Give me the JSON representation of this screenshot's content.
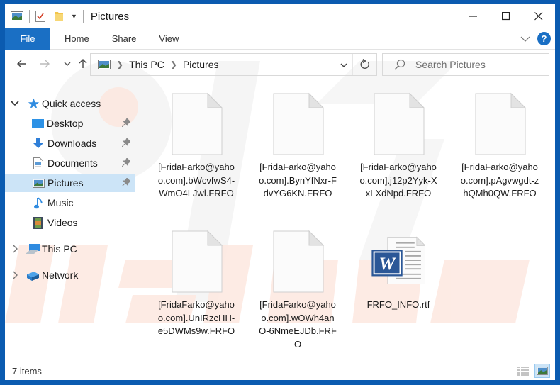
{
  "window": {
    "title": "Pictures",
    "controls": {
      "minimize": "minimize",
      "maximize": "maximize",
      "close": "close"
    }
  },
  "ribbon": {
    "file_tab": "File",
    "tabs": [
      "Home",
      "Share",
      "View"
    ],
    "help": "?"
  },
  "address": {
    "crumbs": [
      "This PC",
      "Pictures"
    ],
    "search_placeholder": "Search Pictures"
  },
  "sidebar": {
    "quick_access": "Quick access",
    "pinned": [
      {
        "label": "Desktop",
        "icon": "desktop-icon",
        "pinned": true
      },
      {
        "label": "Downloads",
        "icon": "downloads-icon",
        "pinned": true
      },
      {
        "label": "Documents",
        "icon": "documents-icon",
        "pinned": true
      },
      {
        "label": "Pictures",
        "icon": "pictures-icon",
        "pinned": true,
        "selected": true
      },
      {
        "label": "Music",
        "icon": "music-icon",
        "pinned": false
      },
      {
        "label": "Videos",
        "icon": "videos-icon",
        "pinned": false
      }
    ],
    "this_pc": "This PC",
    "network": "Network"
  },
  "files": [
    {
      "name": "[FridaFarko@yahoo.com].bWcvfwS4-WmO4LJwl.FRFO",
      "type": "blank"
    },
    {
      "name": "[FridaFarko@yahoo.com].BynYfNxr-FdvYG6KN.FRFO",
      "type": "blank"
    },
    {
      "name": "[FridaFarko@yahoo.com].j12p2Yyk-XxLXdNpd.FRFO",
      "type": "blank"
    },
    {
      "name": "[FridaFarko@yahoo.com].pAgvwgdt-zhQMh0QW.FRFO",
      "type": "blank"
    },
    {
      "name": "[FridaFarko@yahoo.com].UnIRzcHH-e5DWMs9w.FRFO",
      "type": "blank"
    },
    {
      "name": "[FridaFarko@yahoo.com].wOWh4anO-6NmeEJDb.FRFO",
      "type": "blank"
    },
    {
      "name": "FRFO_INFO.rtf",
      "type": "word"
    }
  ],
  "status": {
    "item_count": "7 items"
  },
  "colors": {
    "accent": "#1a6fc4",
    "frame": "#0b5bb0",
    "selection": "#cce4f7"
  }
}
